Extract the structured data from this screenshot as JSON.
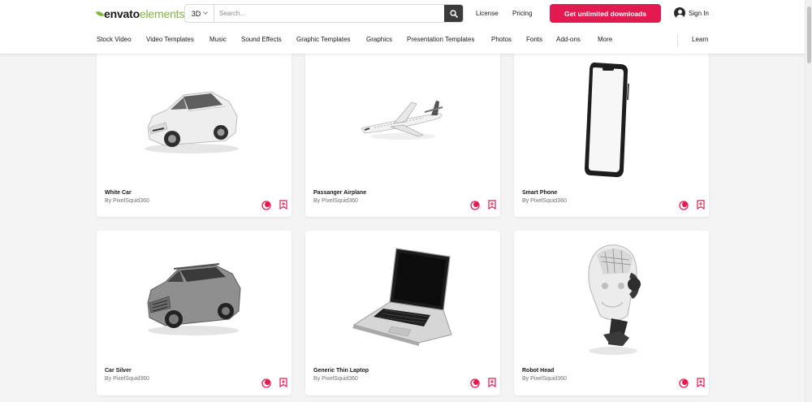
{
  "header": {
    "logo_part1": "envato",
    "logo_part2": "elements",
    "search_category": "3D",
    "search_placeholder": "Search...",
    "license_label": "License",
    "pricing_label": "Pricing",
    "cta_label": "Get unlimited downloads",
    "signin_label": "Sign In"
  },
  "nav": {
    "items": [
      "Stock Video",
      "Video Templates",
      "Music",
      "Sound Effects",
      "Graphic Templates",
      "Graphics",
      "Presentation Templates",
      "Photos",
      "Fonts",
      "Add-ons",
      "More"
    ],
    "learn_label": "Learn"
  },
  "colors": {
    "accent": "#e21a4f",
    "brand_green": "#82b541"
  },
  "cards": [
    {
      "title": "White Car",
      "author": "By PixelSquid360",
      "image": "white-car"
    },
    {
      "title": "Passanger Airplane",
      "author": "By PixelSquid360",
      "image": "airplane"
    },
    {
      "title": "Smart Phone",
      "author": "By PixelSquid360",
      "image": "smartphone"
    },
    {
      "title": "Car Silver",
      "author": "By PixelSquid360",
      "image": "silver-suv"
    },
    {
      "title": "Generic Thin Laptop",
      "author": "By PixelSquid360",
      "image": "laptop"
    },
    {
      "title": "Robot Head",
      "author": "By PixelSquid360",
      "image": "robot-head"
    }
  ]
}
